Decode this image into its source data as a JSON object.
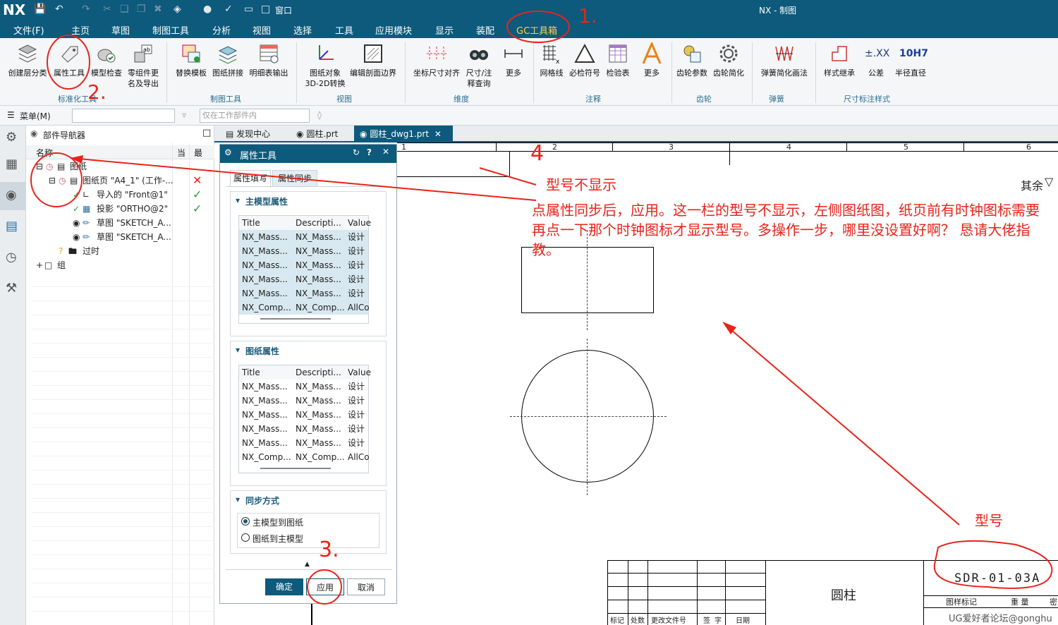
{
  "app": {
    "logo": "NX",
    "title": "NX - 制图",
    "window_menu": "窗口"
  },
  "menu": [
    "文件(F)",
    "主页",
    "草图",
    "制图工具",
    "分析",
    "视图",
    "选择",
    "工具",
    "应用模块",
    "显示",
    "装配",
    "GC工具箱"
  ],
  "ribbon": {
    "buttons": [
      {
        "label": "创建层分类",
        "icon": "layers-icon"
      },
      {
        "label": "属性工具",
        "icon": "tag-icon"
      },
      {
        "label": "模型检查",
        "icon": "model-check-icon"
      },
      {
        "label": "零组件更名及导出",
        "icon": "rename-export-icon"
      },
      {
        "label": "替换模板",
        "icon": "replace-template-icon"
      },
      {
        "label": "图纸拼接",
        "icon": "sheet-join-icon"
      },
      {
        "label": "明细表输出",
        "icon": "parts-list-icon"
      },
      {
        "label": "图纸对象3D-2D转换",
        "icon": "convert-3d2d-icon"
      },
      {
        "label": "编辑剖面边界",
        "icon": "section-boundary-icon"
      },
      {
        "label": "坐标尺寸对齐",
        "icon": "coordinate-align-icon"
      },
      {
        "label": "尺寸/注释查询",
        "icon": "binoculars-icon"
      },
      {
        "label": "更多",
        "icon": "dimension-icon"
      },
      {
        "label": "网格线",
        "icon": "grid-icon"
      },
      {
        "label": "必检符号",
        "icon": "triangle-icon"
      },
      {
        "label": "检验表",
        "icon": "inspection-table-icon"
      },
      {
        "label": "更多",
        "icon": "text-a-icon"
      },
      {
        "label": "齿轮参数",
        "icon": "gear-params-icon"
      },
      {
        "label": "齿轮简化",
        "icon": "gear-icon"
      },
      {
        "label": "弹簧简化画法",
        "icon": "spring-icon"
      },
      {
        "label": "样式继承",
        "icon": "style-inherit-icon"
      },
      {
        "label": "公差",
        "icon": "tolerance-icon"
      },
      {
        "label": "半径直径",
        "icon": "radius-icon"
      }
    ],
    "groups": [
      "标准化工具",
      "制图工具",
      "视图",
      "维度",
      "注释",
      "齿轮",
      "弹簧",
      "尺寸标注样式"
    ],
    "tolerance_text": "±.XX",
    "fit_text": "10H7"
  },
  "cmdbar": {
    "menu_label": "菜单(M)",
    "filter_placeholder": "仅在工作部件内"
  },
  "navigator": {
    "title": "部件导航器",
    "col_name": "名称",
    "col_current": "当",
    "col_latest": "最",
    "rows": [
      {
        "label": "图纸"
      },
      {
        "label": "图纸页 \"A4_1\" (工作-..."
      },
      {
        "label": "导入的 \"Front@1\""
      },
      {
        "label": "投影 \"ORTHO@2\""
      },
      {
        "label": "草图 \"SKETCH_A..."
      },
      {
        "label": "草图 \"SKETCH_A..."
      },
      {
        "label": "过时"
      },
      {
        "label": "组"
      }
    ]
  },
  "tabs": [
    {
      "label": "发现中心"
    },
    {
      "label": "圆柱.prt"
    },
    {
      "label": "圆柱_dwg1.prt"
    }
  ],
  "dialog": {
    "title": "属性工具",
    "tabs": [
      "属性填写",
      "属性同步"
    ],
    "section_model": "主模型属性",
    "section_sheet": "图纸属性",
    "section_sync": "同步方式",
    "columns": [
      "Title",
      "Descripti...",
      "Value"
    ],
    "model_rows": [
      [
        "NX_Mass...",
        "NX_Mass...",
        "设计"
      ],
      [
        "NX_Mass...",
        "NX_Mass...",
        "设计"
      ],
      [
        "NX_Mass...",
        "NX_Mass...",
        "设计"
      ],
      [
        "NX_Mass...",
        "NX_Mass...",
        "设计"
      ],
      [
        "NX_Mass...",
        "NX_Mass...",
        "设计"
      ],
      [
        "NX_Comp...",
        "NX_Comp...",
        "AllCo"
      ]
    ],
    "sheet_rows": [
      [
        "NX_Mass...",
        "NX_Mass...",
        "设计"
      ],
      [
        "NX_Mass...",
        "NX_Mass...",
        "设计"
      ],
      [
        "NX_Mass...",
        "NX_Mass...",
        "设计"
      ],
      [
        "NX_Mass...",
        "NX_Mass...",
        "设计"
      ],
      [
        "NX_Mass...",
        "NX_Mass...",
        "设计"
      ],
      [
        "NX_Comp...",
        "NX_Comp...",
        "AllCo"
      ]
    ],
    "sync_options": [
      "主模型到图纸",
      "图纸到主模型"
    ],
    "sync_selected": 0,
    "ok": "确定",
    "apply": "应用",
    "cancel": "取消"
  },
  "drawing": {
    "ruler": [
      "1",
      "2",
      "3",
      "4",
      "5",
      "6"
    ],
    "surface_text": "其余",
    "part_name": "圆柱",
    "drawing_number": "SDR-01-03A",
    "title_block_labels": [
      "标记",
      "处数",
      "更改文件号",
      "签 字",
      "日期"
    ],
    "title_block_right": [
      "图样标记",
      "重 量",
      "密"
    ],
    "watermark": "UG爱好者论坛@gonghu"
  },
  "annotations": {
    "step1": "1.",
    "step2": "2.",
    "step3": "3.",
    "step4": "4",
    "not_shown": "型号不显示",
    "description": "点属性同步后，应用。这一栏的型号不显示，左侧图纸图，纸页前有时钟图标需要再点一下那个时钟图标才显示型号。多操作一步，哪里没设置好啊？ 恳请大佬指教。",
    "model_label": "型号"
  },
  "colors": {
    "accent": "#0d5a7c",
    "annotation": "#e8231a",
    "highlight": "#ffd24a"
  }
}
